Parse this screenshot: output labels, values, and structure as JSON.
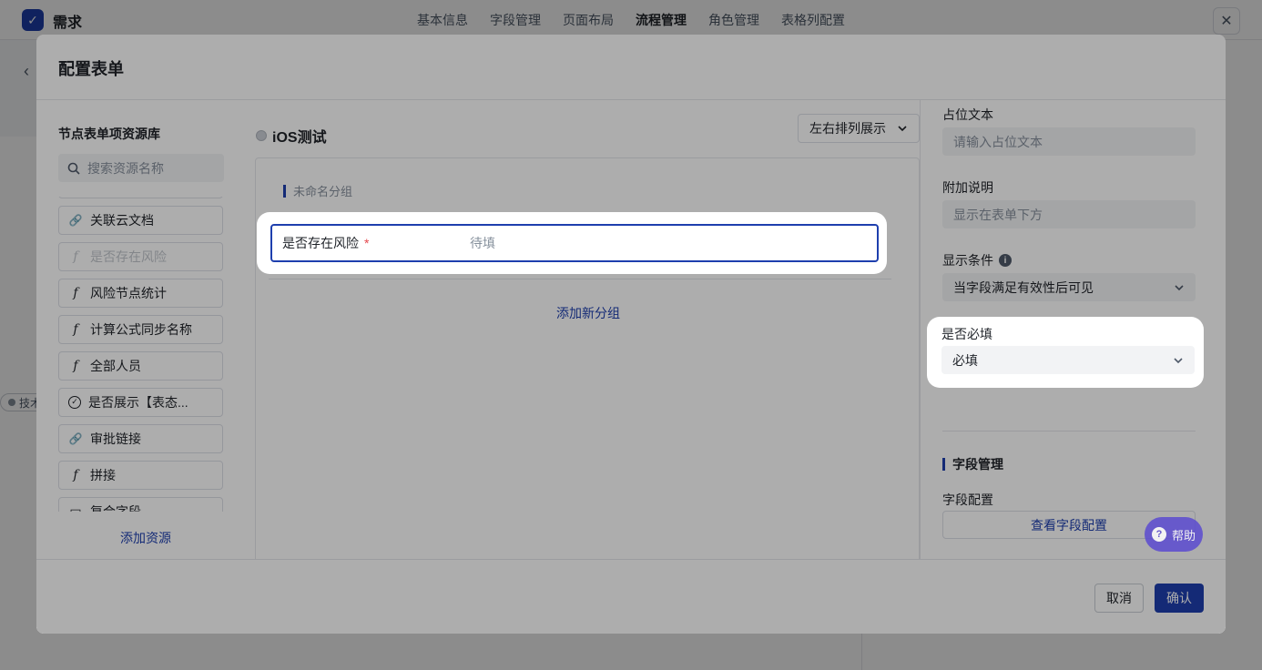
{
  "app": {
    "title": "需求",
    "tabs": [
      "基本信息",
      "字段管理",
      "页面布局",
      "流程管理",
      "角色管理",
      "表格列配置"
    ],
    "active_tab": "流程管理",
    "background_tag": "技术"
  },
  "modal": {
    "title": "配置表单",
    "library": {
      "title": "节点表单项资源库",
      "search_placeholder": "搜索资源名称",
      "items": [
        {
          "icon": "link-icon",
          "glyph": "🔗",
          "label": "关联云文档",
          "disabled": false
        },
        {
          "icon": "formula-icon",
          "glyph": "f",
          "label": "是否存在风险",
          "disabled": true
        },
        {
          "icon": "formula-icon",
          "glyph": "f",
          "label": "风险节点统计",
          "disabled": false
        },
        {
          "icon": "formula-icon",
          "glyph": "f",
          "label": "计算公式同步名称",
          "disabled": false
        },
        {
          "icon": "formula-icon",
          "glyph": "f",
          "label": "全部人员",
          "disabled": false
        },
        {
          "icon": "check-circle-icon",
          "glyph": "✓",
          "label": "是否展示【表态...",
          "disabled": false
        },
        {
          "icon": "link-icon",
          "glyph": "🔗",
          "label": "审批链接",
          "disabled": false
        },
        {
          "icon": "formula-icon",
          "glyph": "f",
          "label": "拼接",
          "disabled": false
        },
        {
          "icon": "composite-icon",
          "glyph": "▭",
          "label": "复合字段",
          "disabled": false
        }
      ],
      "add_resource": "添加资源"
    },
    "form": {
      "name": "iOS测试",
      "layout_option": "左右排列展示",
      "group_name": "未命名分组",
      "field": {
        "label": "是否存在风险",
        "required_mark": "*",
        "placeholder": "待填"
      },
      "add_group": "添加新分组"
    },
    "props": {
      "placeholder_label": "占位文本",
      "placeholder_input": "请输入占位文本",
      "note_label": "附加说明",
      "note_input": "显示在表单下方",
      "condition_label": "显示条件",
      "condition_value": "当字段满足有效性后可见",
      "required_label": "是否必填",
      "required_value": "必填",
      "section_title": "字段管理",
      "config_label": "字段配置",
      "view_config": "查看字段配置"
    },
    "help": "帮助",
    "cancel": "取消",
    "confirm": "确认"
  },
  "colors": {
    "accent": "#1e3fae",
    "required": "#e5484d",
    "help": "#5b4bd1"
  }
}
